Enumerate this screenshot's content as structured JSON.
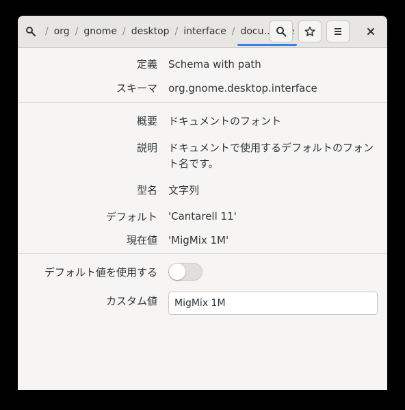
{
  "header": {
    "breadcrumbs": [
      "org",
      "gnome",
      "desktop",
      "interface",
      "docu…ame"
    ],
    "separator": "/",
    "icons": {
      "path_root": "search-settings-icon",
      "search": "search-icon",
      "bookmark": "star-icon",
      "menu": "hamburger-menu-icon",
      "close": "close-icon"
    }
  },
  "details": {
    "definition": {
      "label": "定義",
      "value": "Schema with path"
    },
    "schema": {
      "label": "スキーマ",
      "value": "org.gnome.desktop.interface"
    },
    "summary": {
      "label": "概要",
      "value": "ドキュメントのフォント"
    },
    "description": {
      "label": "説明",
      "value": "ドキュメントで使用するデフォルトのフォント名です。"
    },
    "type": {
      "label": "型名",
      "value": "文字列"
    },
    "default": {
      "label": "デフォルト",
      "value": "'Cantarell 11'"
    },
    "current": {
      "label": "現在値",
      "value": "'MigMix 1M'"
    }
  },
  "editor": {
    "use_default_label": "デフォルト値を使用する",
    "use_default_on": false,
    "custom_value_label": "カスタム値",
    "custom_value": "MigMix 1M"
  },
  "colors": {
    "accent": "#3584e4",
    "window_bg": "#f6f5f4",
    "headerbar_bg": "#e8e6e3"
  }
}
